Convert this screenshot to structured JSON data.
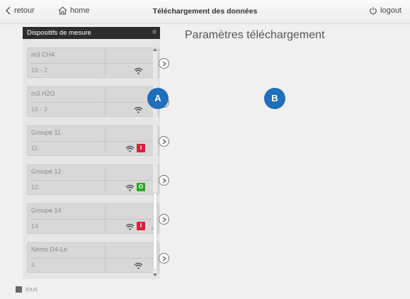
{
  "topbar": {
    "back_label": "retour",
    "home_label": "home",
    "title": "Téléchargement des données",
    "logout_label": "logout"
  },
  "panel": {
    "title": "Dispositifs de mesure",
    "devices": [
      {
        "name": "m3 CH4",
        "code": "16 - 2",
        "status": ""
      },
      {
        "name": "m3 H2O",
        "code": "16 - 3",
        "status": ""
      },
      {
        "name": "Groupe 11",
        "code": "11",
        "status": "I"
      },
      {
        "name": "Groupe 12",
        "code": "12",
        "status": "O"
      },
      {
        "name": "Groupe 14",
        "code": "14",
        "status": "I"
      },
      {
        "name": "Nemo D4-Le",
        "code": "4",
        "status": ""
      }
    ]
  },
  "footer": {
    "checkbox_label": "tous"
  },
  "main": {
    "title": "Paramètres téléchargement"
  },
  "markers": {
    "a": "A",
    "b": "B"
  },
  "colors": {
    "status_off": "#d2233b",
    "status_on": "#29a82a",
    "marker": "#1f6fba",
    "panel_header": "#2c2c2c"
  }
}
